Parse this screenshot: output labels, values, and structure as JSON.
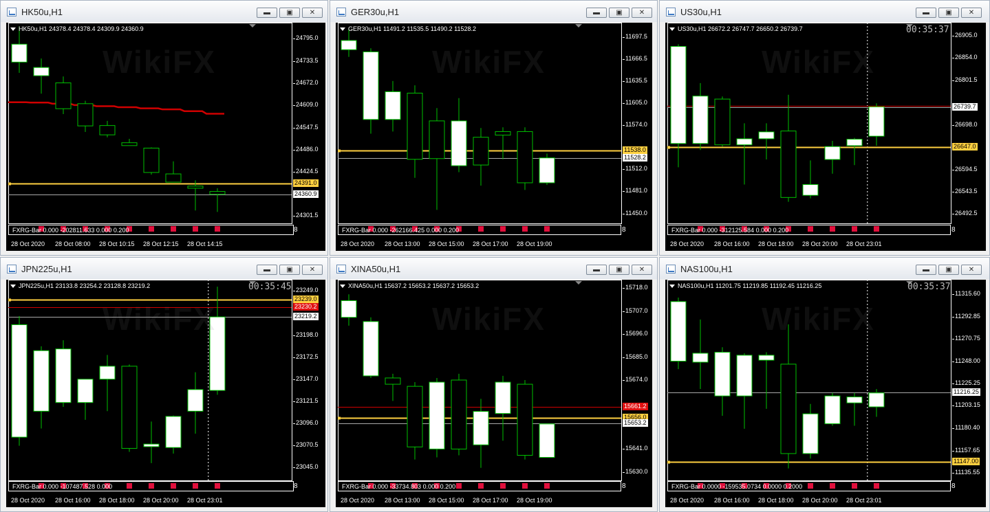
{
  "windows": [
    {
      "key": "hk",
      "title": "HK50u,H1",
      "header": "HK50u,H1  24378.4 24378.4 24309.9 24360.9",
      "timer": "",
      "indicator": "FXRG-Bar 0.000 -202811.633 0.000 0.200",
      "indicator_axis": "8",
      "colors": {
        "bull": "#ffffff",
        "outline": "#00c000",
        "ma": "#d00000",
        "ask": "#ffd040",
        "bid": "#aaaaaa"
      },
      "chart_data": {
        "type": "candlestick",
        "ylim": [
          24280,
          24840
        ],
        "yticks": [
          {
            "v": 24795.0,
            "label": "24795.0"
          },
          {
            "v": 24733.5,
            "label": "24733.5"
          },
          {
            "v": 24672.0,
            "label": "24672.0"
          },
          {
            "v": 24609.0,
            "label": "24609.0"
          },
          {
            "v": 24547.5,
            "label": "24547.5"
          },
          {
            "v": 24486.0,
            "label": "24486.0"
          },
          {
            "v": 24424.5,
            "label": "24424.5"
          },
          {
            "v": 24301.5,
            "label": "24301.5"
          }
        ],
        "xticks": [
          {
            "i": 0,
            "label": "28 Oct 2020"
          },
          {
            "i": 2,
            "label": "28 Oct 08:00"
          },
          {
            "i": 4,
            "label": "28 Oct 10:15"
          },
          {
            "i": 6,
            "label": "28 Oct 12:15"
          },
          {
            "i": 8,
            "label": "28 Oct 14:15"
          }
        ],
        "candles": [
          {
            "o": 24730,
            "h": 24830,
            "l": 24700,
            "c": 24780
          },
          {
            "o": 24692,
            "h": 24740,
            "l": 24642,
            "c": 24715
          },
          {
            "o": 24672,
            "h": 24690,
            "l": 24585,
            "c": 24600
          },
          {
            "o": 24614,
            "h": 24622,
            "l": 24535,
            "c": 24552
          },
          {
            "o": 24553,
            "h": 24566,
            "l": 24520,
            "c": 24527
          },
          {
            "o": 24505,
            "h": 24516,
            "l": 24497,
            "c": 24497
          },
          {
            "o": 24490,
            "h": 24492,
            "l": 24416,
            "c": 24422
          },
          {
            "o": 24418,
            "h": 24453,
            "l": 24395,
            "c": 24395
          },
          {
            "o": 24384,
            "h": 24400,
            "l": 24316,
            "c": 24378
          },
          {
            "o": 24369,
            "h": 24378,
            "l": 24312,
            "c": 24361
          }
        ],
        "ma": [
          24618,
          24617,
          24614,
          24610,
          24607,
          24604,
          24601,
          24598,
          24593,
          24586
        ],
        "levels": [
          {
            "v": 24391.0,
            "label": "24391.0",
            "kind": "ask"
          },
          {
            "v": 24360.9,
            "label": "24360.9",
            "kind": "bid"
          }
        ],
        "vline": null
      }
    },
    {
      "key": "ger",
      "title": "GER30u,H1",
      "header": "GER30u,H1  11491.2 11535.5 11490.2 11528.2",
      "timer": "",
      "indicator": "FXRG-Bar 0.000 -262166.425 0.000 0.200",
      "indicator_axis": "8",
      "colors": {
        "bull": "#ffffff",
        "outline": "#00c000",
        "ma": "#d00000",
        "ask": "#ffd040",
        "bid": "#aaaaaa"
      },
      "chart_data": {
        "type": "candlestick",
        "ylim": [
          11436,
          11718
        ],
        "yticks": [
          {
            "v": 11697.5,
            "label": "11697.5"
          },
          {
            "v": 11666.5,
            "label": "11666.5"
          },
          {
            "v": 11635.5,
            "label": "11635.5"
          },
          {
            "v": 11605.0,
            "label": "11605.0"
          },
          {
            "v": 11574.0,
            "label": "11574.0"
          },
          {
            "v": 11512.0,
            "label": "11512.0"
          },
          {
            "v": 11481.0,
            "label": "11481.0"
          },
          {
            "v": 11450.0,
            "label": "11450.0"
          }
        ],
        "xticks": [
          {
            "i": 0,
            "label": "28 Oct 2020"
          },
          {
            "i": 2,
            "label": "28 Oct 13:00"
          },
          {
            "i": 4,
            "label": "28 Oct 15:00"
          },
          {
            "i": 6,
            "label": "28 Oct 17:00"
          },
          {
            "i": 8,
            "label": "28 Oct 19:00"
          }
        ],
        "candles": [
          {
            "o": 11680,
            "h": 11710,
            "l": 11670,
            "c": 11693
          },
          {
            "o": 11582,
            "h": 11682,
            "l": 11562,
            "c": 11677
          },
          {
            "o": 11582,
            "h": 11636,
            "l": 11565,
            "c": 11621
          },
          {
            "o": 11619,
            "h": 11630,
            "l": 11500,
            "c": 11526
          },
          {
            "o": 11580,
            "h": 11598,
            "l": 11455,
            "c": 11527
          },
          {
            "o": 11517,
            "h": 11612,
            "l": 11508,
            "c": 11580
          },
          {
            "o": 11557,
            "h": 11570,
            "l": 11489,
            "c": 11518
          },
          {
            "o": 11565,
            "h": 11571,
            "l": 11526,
            "c": 11560
          },
          {
            "o": 11565,
            "h": 11571,
            "l": 11483,
            "c": 11493
          },
          {
            "o": 11493,
            "h": 11534,
            "l": 11490,
            "c": 11528
          }
        ],
        "ma": null,
        "levels": [
          {
            "v": 11538.0,
            "label": "11538.0",
            "kind": "ask"
          },
          {
            "v": 11528.2,
            "label": "11528.2",
            "kind": "bid"
          }
        ],
        "vline": null
      }
    },
    {
      "key": "us",
      "title": "US30u,H1",
      "header": "US30u,H1  26672.2 26747.7 26650.2 26739.7",
      "timer": "00:35:37",
      "indicator": "FXRG-Bar 0.000 -312125.584 0.000 0.200",
      "indicator_axis": "8",
      "colors": {
        "bull": "#ffffff",
        "outline": "#00c000",
        "ma": "#d00000",
        "ask": "#ffd040",
        "bid": "#aaaaaa"
      },
      "chart_data": {
        "type": "candlestick",
        "ylim": [
          26470,
          26935
        ],
        "yticks": [
          {
            "v": 26905.0,
            "label": "26905.0"
          },
          {
            "v": 26854.0,
            "label": "26854.0"
          },
          {
            "v": 26801.5,
            "label": "26801.5"
          },
          {
            "v": 26698.0,
            "label": "26698.0"
          },
          {
            "v": 26594.5,
            "label": "26594.5"
          },
          {
            "v": 26543.5,
            "label": "26543.5"
          },
          {
            "v": 26492.5,
            "label": "26492.5"
          }
        ],
        "xticks": [
          {
            "i": 0,
            "label": "28 Oct 2020"
          },
          {
            "i": 2,
            "label": "28 Oct 16:00"
          },
          {
            "i": 4,
            "label": "28 Oct 18:00"
          },
          {
            "i": 6,
            "label": "28 Oct 20:00"
          },
          {
            "i": 8,
            "label": "28 Oct 23:01"
          }
        ],
        "candles": [
          {
            "o": 26655,
            "h": 26885,
            "l": 26600,
            "c": 26880
          },
          {
            "o": 26655,
            "h": 26795,
            "l": 26640,
            "c": 26765
          },
          {
            "o": 26758,
            "h": 26764,
            "l": 26648,
            "c": 26652
          },
          {
            "o": 26652,
            "h": 26702,
            "l": 26560,
            "c": 26666
          },
          {
            "o": 26666,
            "h": 26702,
            "l": 26618,
            "c": 26682
          },
          {
            "o": 26684,
            "h": 26768,
            "l": 26520,
            "c": 26530
          },
          {
            "o": 26535,
            "h": 26616,
            "l": 26528,
            "c": 26560
          },
          {
            "o": 26618,
            "h": 26661,
            "l": 26585,
            "c": 26648
          },
          {
            "o": 26650,
            "h": 26668,
            "l": 26605,
            "c": 26665
          },
          {
            "o": 26672,
            "h": 26748,
            "l": 26650,
            "c": 26740
          }
        ],
        "ma": null,
        "levels": [
          {
            "v": 26647.0,
            "label": "26647.0",
            "kind": "ask"
          },
          {
            "v": 26739.7,
            "label": "26739.7",
            "kind": "bid"
          },
          {
            "v": 26742.0,
            "label": "",
            "kind": "ma-line"
          }
        ],
        "vline": 8.9
      }
    },
    {
      "key": "jpn",
      "title": "JPN225u,H1",
      "header": "JPN225u,H1  23133.8 23254.2 23128.8 23219.2",
      "timer": "00:35:45",
      "indicator": "FXRG-Bar 0.000 -107487.528 0.000",
      "indicator_axis": "8",
      "colors": {
        "bull": "#ffffff",
        "outline": "#00c000",
        "ma": "#d00000",
        "ask": "#ffd040",
        "bid": "#aaaaaa",
        "ma_badge": "#e01010"
      },
      "chart_data": {
        "type": "candlestick",
        "ylim": [
          23030,
          23262
        ],
        "yticks": [
          {
            "v": 23249.0,
            "label": "23249.0"
          },
          {
            "v": 23198.0,
            "label": "23198.0"
          },
          {
            "v": 23172.5,
            "label": "23172.5"
          },
          {
            "v": 23147.0,
            "label": "23147.0"
          },
          {
            "v": 23121.5,
            "label": "23121.5"
          },
          {
            "v": 23096.0,
            "label": "23096.0"
          },
          {
            "v": 23070.5,
            "label": "23070.5"
          },
          {
            "v": 23045.0,
            "label": "23045.0"
          }
        ],
        "xticks": [
          {
            "i": 0,
            "label": "28 Oct 2020"
          },
          {
            "i": 2,
            "label": "28 Oct 16:00"
          },
          {
            "i": 4,
            "label": "28 Oct 18:00"
          },
          {
            "i": 6,
            "label": "28 Oct 20:00"
          },
          {
            "i": 8,
            "label": "28 Oct 23:01"
          }
        ],
        "candles": [
          {
            "o": 23080,
            "h": 23220,
            "l": 23070,
            "c": 23210
          },
          {
            "o": 23110,
            "h": 23185,
            "l": 23090,
            "c": 23180
          },
          {
            "o": 23120,
            "h": 23192,
            "l": 23115,
            "c": 23182
          },
          {
            "o": 23120,
            "h": 23144,
            "l": 23100,
            "c": 23147
          },
          {
            "o": 23147,
            "h": 23175,
            "l": 23110,
            "c": 23162
          },
          {
            "o": 23162,
            "h": 23164,
            "l": 23063,
            "c": 23067
          },
          {
            "o": 23069,
            "h": 23098,
            "l": 23050,
            "c": 23072
          },
          {
            "o": 23068,
            "h": 23105,
            "l": 23061,
            "c": 23104
          },
          {
            "o": 23110,
            "h": 23155,
            "l": 23084,
            "c": 23135
          },
          {
            "o": 23134,
            "h": 23254,
            "l": 23129,
            "c": 23219
          }
        ],
        "ma": null,
        "levels": [
          {
            "v": 23239.0,
            "label": "23239.0",
            "kind": "ask"
          },
          {
            "v": 23230.2,
            "label": "23230.2",
            "kind": "ma-badge"
          },
          {
            "v": 23219.2,
            "label": "23219.2",
            "kind": "bid"
          }
        ],
        "vline": 8.9
      }
    },
    {
      "key": "xina",
      "title": "XINA50u,H1",
      "header": "XINA50u,H1  15637.2 15653.2 15637.2 15653.2",
      "timer": "",
      "indicator": "FXRG-Bar 0.000 -33734.803 0.000 0.200",
      "indicator_axis": "8",
      "colors": {
        "bull": "#ffffff",
        "outline": "#00c000",
        "ma": "#d00000",
        "ask": "#ffd040",
        "bid": "#aaaaaa",
        "ma_badge": "#e01010"
      },
      "chart_data": {
        "type": "candlestick",
        "ylim": [
          15626,
          15722
        ],
        "yticks": [
          {
            "v": 15718.0,
            "label": "15718.0"
          },
          {
            "v": 15707.0,
            "label": "15707.0"
          },
          {
            "v": 15696.0,
            "label": "15696.0"
          },
          {
            "v": 15685.0,
            "label": "15685.0"
          },
          {
            "v": 15674.0,
            "label": "15674.0"
          },
          {
            "v": 15641.0,
            "label": "15641.0"
          },
          {
            "v": 15630.0,
            "label": "15630.0"
          }
        ],
        "xticks": [
          {
            "i": 0,
            "label": "28 Oct 2020"
          },
          {
            "i": 2,
            "label": "28 Oct 13:00"
          },
          {
            "i": 4,
            "label": "28 Oct 15:00"
          },
          {
            "i": 6,
            "label": "28 Oct 17:00"
          },
          {
            "i": 8,
            "label": "28 Oct 19:00"
          }
        ],
        "candles": [
          {
            "o": 15704,
            "h": 15715,
            "l": 15700,
            "c": 15712
          },
          {
            "o": 15676,
            "h": 15704,
            "l": 15675,
            "c": 15702
          },
          {
            "o": 15675,
            "h": 15677,
            "l": 15664,
            "c": 15672
          },
          {
            "o": 15671,
            "h": 15673,
            "l": 15636,
            "c": 15642
          },
          {
            "o": 15641,
            "h": 15675,
            "l": 15637,
            "c": 15673
          },
          {
            "o": 15674,
            "h": 15677,
            "l": 15638,
            "c": 15641
          },
          {
            "o": 15643,
            "h": 15665,
            "l": 15632,
            "c": 15659
          },
          {
            "o": 15658,
            "h": 15676,
            "l": 15645,
            "c": 15673
          },
          {
            "o": 15672,
            "h": 15674,
            "l": 15636,
            "c": 15638
          },
          {
            "o": 15637,
            "h": 15653,
            "l": 15637,
            "c": 15653
          }
        ],
        "ma": null,
        "levels": [
          {
            "v": 15661.2,
            "label": "15661.2",
            "kind": "ma-badge"
          },
          {
            "v": 15656.0,
            "label": "15656.0",
            "kind": "ask"
          },
          {
            "v": 15653.2,
            "label": "15653.2",
            "kind": "bid"
          }
        ],
        "vline": null
      }
    },
    {
      "key": "nas",
      "title": "NAS100u,H1",
      "header": "NAS100u,H1  11201.75 11219.85 11192.45 11216.25",
      "timer": "00:35:37",
      "indicator": "FXRG-Bar 0.0000 -159535.0734 0.0000 0.2000",
      "indicator_axis": "8",
      "colors": {
        "bull": "#ffffff",
        "outline": "#00c000",
        "ma": "#d00000",
        "ask": "#ffd040",
        "bid": "#aaaaaa"
      },
      "chart_data": {
        "type": "candlestick",
        "ylim": [
          11128,
          11330
        ],
        "yticks": [
          {
            "v": 11315.6,
            "label": "11315.60"
          },
          {
            "v": 11292.85,
            "label": "11292.85"
          },
          {
            "v": 11270.75,
            "label": "11270.75"
          },
          {
            "v": 11248.0,
            "label": "11248.00"
          },
          {
            "v": 11225.25,
            "label": "11225.25"
          },
          {
            "v": 11203.15,
            "label": "11203.15"
          },
          {
            "v": 11180.4,
            "label": "11180.40"
          },
          {
            "v": 11157.65,
            "label": "11157.65"
          },
          {
            "v": 11135.55,
            "label": "11135.55"
          }
        ],
        "xticks": [
          {
            "i": 0,
            "label": "28 Oct 2020"
          },
          {
            "i": 2,
            "label": "28 Oct 16:00"
          },
          {
            "i": 4,
            "label": "28 Oct 18:00"
          },
          {
            "i": 6,
            "label": "28 Oct 20:00"
          },
          {
            "i": 8,
            "label": "28 Oct 23:01"
          }
        ],
        "candles": [
          {
            "o": 11248,
            "h": 11312,
            "l": 11240,
            "c": 11308
          },
          {
            "o": 11247,
            "h": 11290,
            "l": 11220,
            "c": 11256
          },
          {
            "o": 11213,
            "h": 11262,
            "l": 11193,
            "c": 11257
          },
          {
            "o": 11213,
            "h": 11256,
            "l": 11180,
            "c": 11254
          },
          {
            "o": 11249,
            "h": 11257,
            "l": 11200,
            "c": 11254
          },
          {
            "o": 11245,
            "h": 11285,
            "l": 11140,
            "c": 11155
          },
          {
            "o": 11155,
            "h": 11205,
            "l": 11150,
            "c": 11195
          },
          {
            "o": 11185,
            "h": 11216,
            "l": 11183,
            "c": 11213
          },
          {
            "o": 11206,
            "h": 11216,
            "l": 11183,
            "c": 11212
          },
          {
            "o": 11202,
            "h": 11220,
            "l": 11192,
            "c": 11216
          }
        ],
        "ma": null,
        "levels": [
          {
            "v": 11216.25,
            "label": "11216.25",
            "kind": "bid"
          },
          {
            "v": 11147.0,
            "label": "11147.00",
            "kind": "ask"
          }
        ],
        "vline": 8.9
      }
    }
  ],
  "watermark": "WikiFX"
}
